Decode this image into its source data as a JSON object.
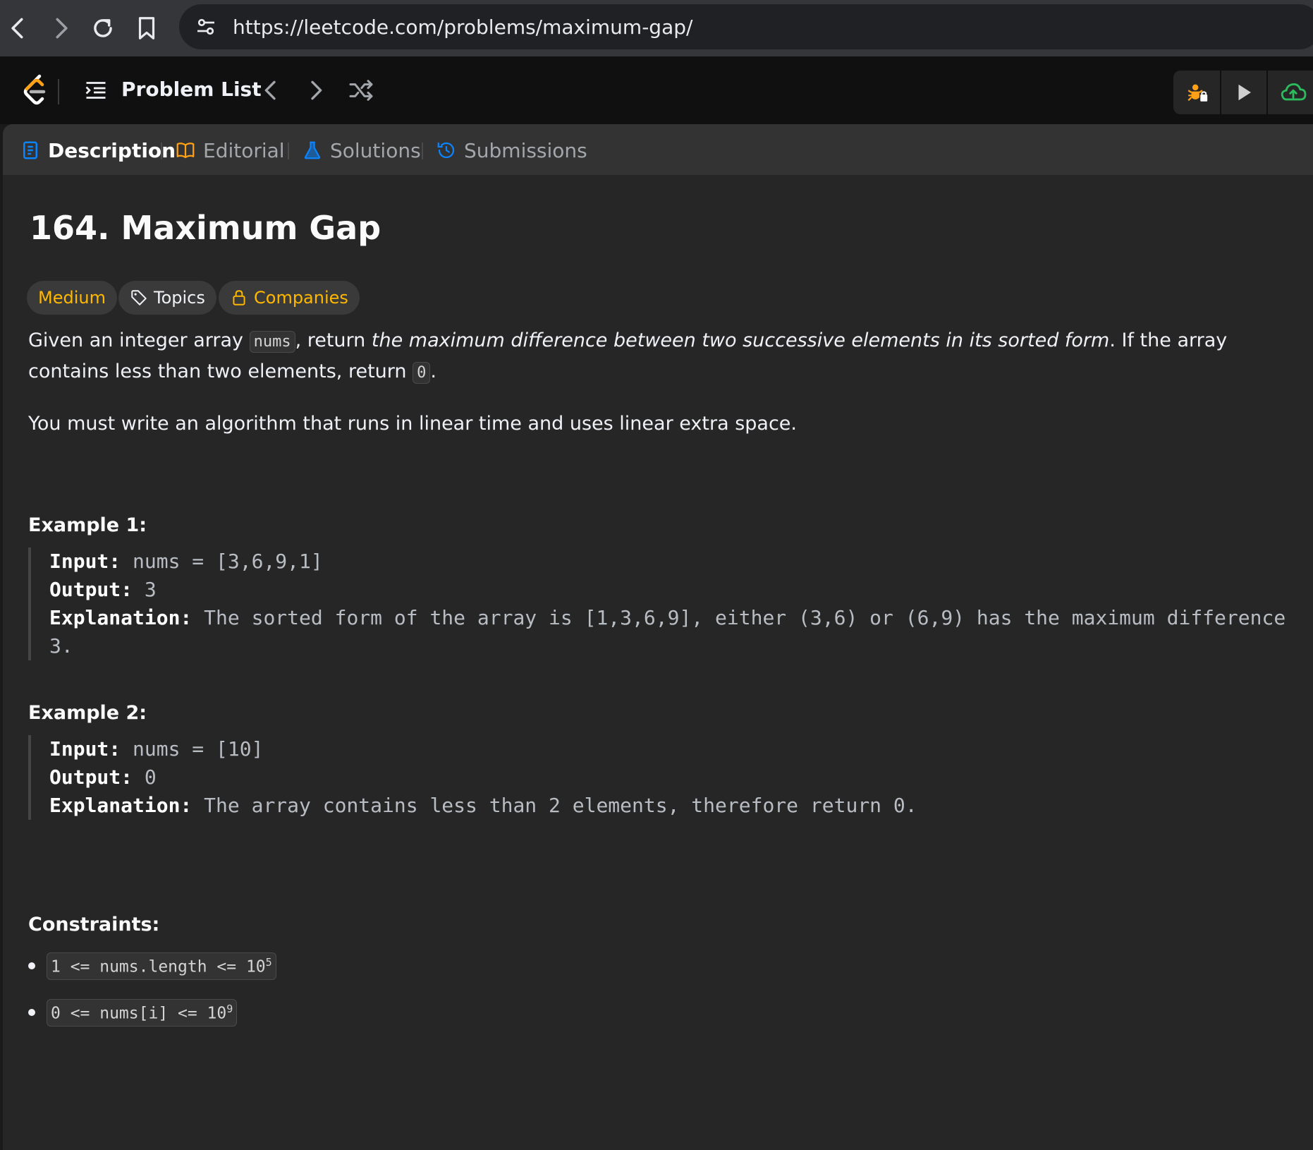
{
  "browser": {
    "url": "https://leetcode.com/problems/maximum-gap/"
  },
  "nav": {
    "problem_list_label": "Problem List"
  },
  "tabs": [
    {
      "label": "Description",
      "active": true
    },
    {
      "label": "Editorial",
      "active": false
    },
    {
      "label": "Solutions",
      "active": false
    },
    {
      "label": "Submissions",
      "active": false
    }
  ],
  "problem": {
    "title": "164. Maximum Gap",
    "difficulty": "Medium",
    "topics_label": "Topics",
    "companies_label": "Companies",
    "desc_part1": "Given an integer array ",
    "desc_code1": "nums",
    "desc_part2": ", return ",
    "desc_em": "the maximum difference between two successive elements in its sorted form",
    "desc_part3": ". If the array contains less than two elements, return ",
    "desc_code2": "0",
    "desc_part4": ".",
    "desc_line2": "You must write an algorithm that runs in linear time and uses linear extra space."
  },
  "examples": [
    {
      "heading": "Example 1:",
      "input_label": "Input:",
      "input": " nums = [3,6,9,1]",
      "output_label": "Output:",
      "output": " 3",
      "explanation_label": "Explanation:",
      "explanation": " The sorted form of the array is [1,3,6,9], either (3,6) or (6,9) has the maximum difference",
      "explanation_cont": "3."
    },
    {
      "heading": "Example 2:",
      "input_label": "Input:",
      "input": " nums = [10]",
      "output_label": "Output:",
      "output": " 0",
      "explanation_label": "Explanation:",
      "explanation": " The array contains less than 2 elements, therefore return 0."
    }
  ],
  "constraints": {
    "heading": "Constraints:",
    "items": [
      {
        "text": "1 <= nums.length <= 10",
        "sup": "5"
      },
      {
        "text": "0 <= nums[i] <= 10",
        "sup": "9"
      }
    ]
  },
  "colors": {
    "medium": "#ffb800",
    "accent_blue": "#0a84ff",
    "editorial_orange": "#ffa116",
    "submit_green": "#2cbb5d"
  },
  "icons": [
    "back-icon",
    "forward-icon",
    "reload-icon",
    "bookmark-icon",
    "site-settings-icon",
    "leetcode-logo",
    "list-icon",
    "prev-icon",
    "next-icon",
    "shuffle-icon",
    "debug-icon",
    "run-icon",
    "submit-cloud-icon",
    "description-icon",
    "book-icon",
    "flask-icon",
    "history-icon",
    "tag-icon",
    "lock-icon"
  ]
}
